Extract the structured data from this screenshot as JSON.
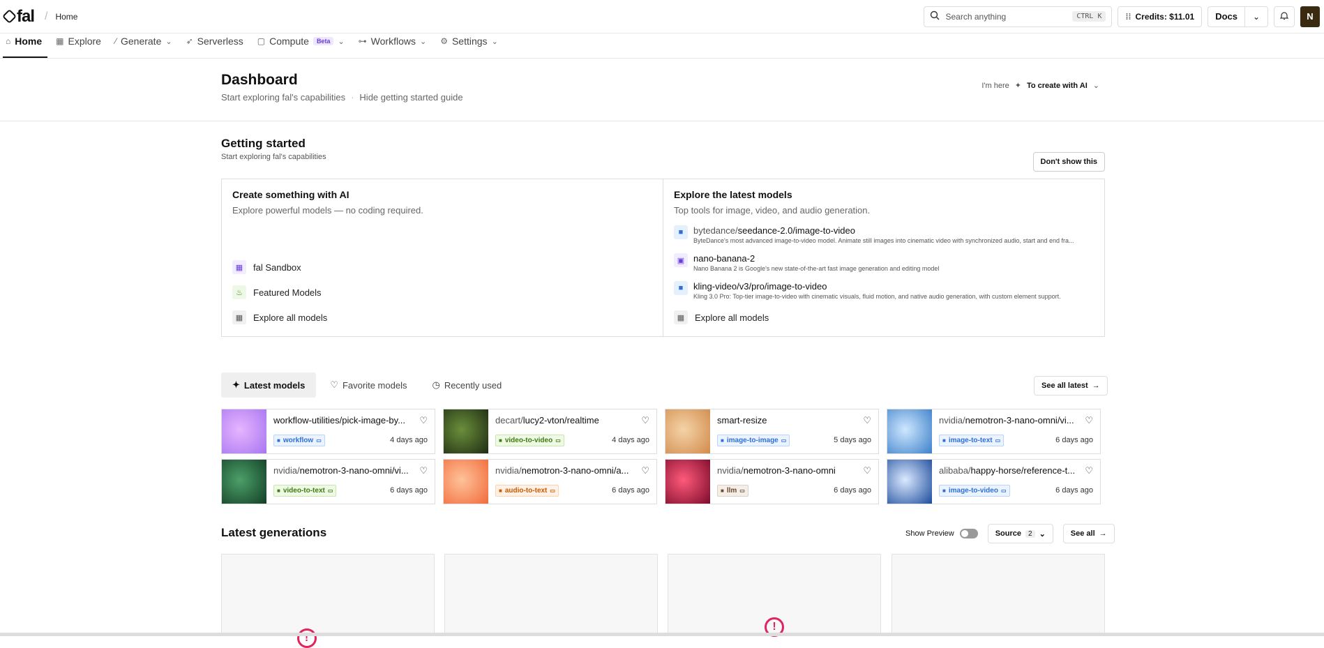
{
  "brand": {
    "name": "fal"
  },
  "breadcrumb": {
    "current": "Home"
  },
  "search": {
    "placeholder": "Search anything",
    "shortcut": "CTRL K"
  },
  "credits": {
    "label": "Credits: $11.01"
  },
  "docs": {
    "label": "Docs"
  },
  "user": {
    "initial": "N"
  },
  "nav": [
    {
      "label": "Home",
      "icon": "home-icon",
      "active": true
    },
    {
      "label": "Explore",
      "icon": "grid-icon"
    },
    {
      "label": "Generate",
      "icon": "wand-icon",
      "dropdown": true
    },
    {
      "label": "Serverless",
      "icon": "rocket-icon"
    },
    {
      "label": "Compute",
      "icon": "cpu-icon",
      "badge": "Beta",
      "dropdown": true
    },
    {
      "label": "Workflows",
      "icon": "flow-icon",
      "dropdown": true
    },
    {
      "label": "Settings",
      "icon": "gear-icon",
      "dropdown": true
    }
  ],
  "dashboard": {
    "title": "Dashboard",
    "subtitle": "Start exploring fal's capabilities",
    "hide_link": "Hide getting started guide",
    "im_here": "I'm here",
    "goal": "To create with AI"
  },
  "getting_started": {
    "title": "Getting started",
    "subtitle": "Start exploring fal's capabilities",
    "dismiss": "Don't show this",
    "create": {
      "title": "Create something with AI",
      "subtitle": "Explore powerful models — no coding required.",
      "links": [
        "fal Sandbox",
        "Featured Models",
        "Explore all models"
      ]
    },
    "explore": {
      "title": "Explore the latest models",
      "subtitle": "Top tools for image, video, and audio generation.",
      "models": [
        {
          "prefix": "bytedance/",
          "name": "seedance-2.0/image-to-video",
          "desc": "ByteDance's most advanced image-to-video model. Animate still images into cinematic video with synchronized audio, start and end fra..."
        },
        {
          "prefix": "",
          "name": "nano-banana-2",
          "desc": "Nano Banana 2 is Google's new state-of-the-art fast image generation and editing model"
        },
        {
          "prefix": "",
          "name": "kling-video/v3/pro/image-to-video",
          "desc": "Kling 3.0 Pro: Top-tier image-to-video with cinematic visuals, fluid motion, and native audio generation, with custom element support."
        }
      ],
      "all_link": "Explore all models"
    }
  },
  "tabs": [
    "Latest models",
    "Favorite models",
    "Recently used"
  ],
  "see_all_latest": "See all latest",
  "latest_models": [
    {
      "prefix": "",
      "name": "workflow-utilities/pick-image-by...",
      "tag": "workflow",
      "tag_color": "blue",
      "age": "4 days ago",
      "thumb": [
        "#e7b5ff",
        "#a675f0"
      ]
    },
    {
      "prefix": "decart/",
      "name": "lucy2-vton/realtime",
      "tag": "video-to-video",
      "tag_color": "green",
      "age": "4 days ago",
      "thumb": [
        "#6a8f3a",
        "#1e2a14"
      ]
    },
    {
      "prefix": "",
      "name": "smart-resize",
      "tag": "image-to-image",
      "tag_color": "blue",
      "age": "5 days ago",
      "thumb": [
        "#f4d3a8",
        "#d18a4a"
      ]
    },
    {
      "prefix": "nvidia/",
      "name": "nemotron-3-nano-omni/vi...",
      "tag": "image-to-text",
      "tag_color": "blue",
      "age": "6 days ago",
      "thumb": [
        "#cfe7ff",
        "#3a7fc8"
      ]
    },
    {
      "prefix": "nvidia/",
      "name": "nemotron-3-nano-omni/vi...",
      "tag": "video-to-text",
      "tag_color": "green",
      "age": "6 days ago",
      "thumb": [
        "#4ca06a",
        "#123d24"
      ]
    },
    {
      "prefix": "nvidia/",
      "name": "nemotron-3-nano-omni/a...",
      "tag": "audio-to-text",
      "tag_color": "orange",
      "age": "6 days ago",
      "thumb": [
        "#ffc29a",
        "#f06a3a"
      ]
    },
    {
      "prefix": "nvidia/",
      "name": "nemotron-3-nano-omni",
      "tag": "llm",
      "tag_color": "brown",
      "age": "6 days ago",
      "thumb": [
        "#ff5a7a",
        "#7a0a2a"
      ]
    },
    {
      "prefix": "alibaba/",
      "name": "happy-horse/reference-t...",
      "tag": "image-to-video",
      "tag_color": "blue",
      "age": "6 days ago",
      "thumb": [
        "#dbe9ff",
        "#1a4a9a"
      ]
    }
  ],
  "latest_generations": {
    "title": "Latest generations",
    "show_preview": "Show Preview",
    "source": "Source",
    "source_count": "2",
    "see_all": "See all"
  }
}
